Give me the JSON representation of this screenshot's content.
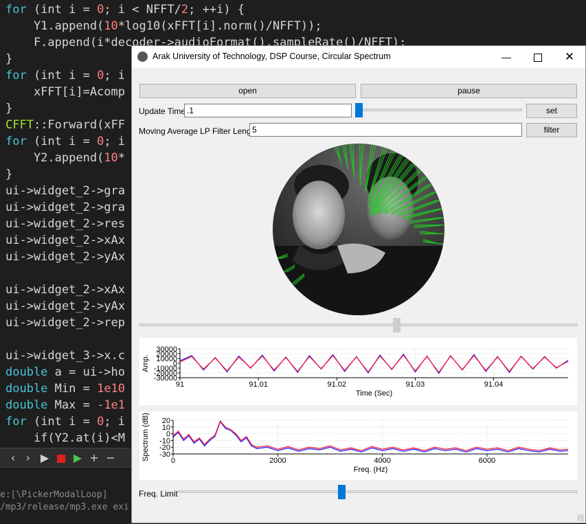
{
  "editor": {
    "lines": [
      {
        "parts": [
          {
            "t": "for",
            "c": "kw"
          },
          {
            "t": " (int i = "
          },
          {
            "t": "0",
            "c": "num"
          },
          {
            "t": "; i < NFFT/"
          },
          {
            "t": "2",
            "c": "num"
          },
          {
            "t": "; ++i) {"
          }
        ]
      },
      {
        "parts": [
          {
            "t": "    Y1.append("
          },
          {
            "t": "10",
            "c": "num"
          },
          {
            "t": "*log10(xFFT[i].norm()/NFFT));"
          }
        ]
      },
      {
        "parts": [
          {
            "t": "    F.append(i*decoder->audioFormat().sampleRate()/NFFT);"
          }
        ]
      },
      {
        "parts": [
          {
            "t": "}"
          }
        ]
      },
      {
        "parts": [
          {
            "t": "for",
            "c": "kw"
          },
          {
            "t": " (int i = "
          },
          {
            "t": "0",
            "c": "num"
          },
          {
            "t": "; i"
          }
        ]
      },
      {
        "parts": [
          {
            "t": "    xFFT[i]=Acomp"
          }
        ]
      },
      {
        "parts": [
          {
            "t": "}"
          }
        ]
      },
      {
        "parts": [
          {
            "t": "CFFT",
            "c": "cls"
          },
          {
            "t": "::Forward(xFF"
          }
        ]
      },
      {
        "parts": [
          {
            "t": "for",
            "c": "kw"
          },
          {
            "t": " (int i = "
          },
          {
            "t": "0",
            "c": "num"
          },
          {
            "t": "; i"
          }
        ]
      },
      {
        "parts": [
          {
            "t": "    Y2.append("
          },
          {
            "t": "10",
            "c": "num"
          },
          {
            "t": "*"
          }
        ]
      },
      {
        "parts": [
          {
            "t": "}"
          }
        ]
      },
      {
        "parts": [
          {
            "t": "ui->widget_2->gra"
          }
        ]
      },
      {
        "parts": [
          {
            "t": "ui->widget_2->gra"
          }
        ]
      },
      {
        "parts": [
          {
            "t": "ui->widget_2->res"
          }
        ]
      },
      {
        "parts": [
          {
            "t": "ui->widget_2->xAx"
          }
        ]
      },
      {
        "parts": [
          {
            "t": "ui->widget_2->yAx"
          }
        ]
      },
      {
        "parts": [
          {
            "t": ""
          }
        ]
      },
      {
        "parts": [
          {
            "t": "ui->widget_2->xAx"
          }
        ]
      },
      {
        "parts": [
          {
            "t": "ui->widget_2->yAx"
          }
        ]
      },
      {
        "parts": [
          {
            "t": "ui->widget_2->rep"
          }
        ]
      },
      {
        "parts": [
          {
            "t": ""
          }
        ]
      },
      {
        "parts": [
          {
            "t": "ui->widget_3->x.c"
          }
        ]
      },
      {
        "parts": [
          {
            "t": "double",
            "c": "kw"
          },
          {
            "t": " a = ui->ho"
          }
        ]
      },
      {
        "parts": [
          {
            "t": "double",
            "c": "kw"
          },
          {
            "t": " Min = "
          },
          {
            "t": "1e10",
            "c": "num"
          }
        ]
      },
      {
        "parts": [
          {
            "t": "double",
            "c": "kw"
          },
          {
            "t": " Max = "
          },
          {
            "t": "-1e1",
            "c": "num"
          }
        ]
      },
      {
        "parts": [
          {
            "t": "for",
            "c": "kw"
          },
          {
            "t": " (int i = "
          },
          {
            "t": "0",
            "c": "num"
          },
          {
            "t": "; i"
          }
        ]
      },
      {
        "parts": [
          {
            "t": "    if(Y2.at(i)<M"
          }
        ]
      }
    ],
    "output_lines": [
      "e:[\\PickerModalLoop]",
      "/mp3/release/mp3.exe exi"
    ]
  },
  "window": {
    "title": "Arak University of Technology, DSP Course, Circular Spectrum",
    "open_label": "open",
    "pause_label": "pause",
    "update_time_label": "Update Time",
    "update_time_value": ".1",
    "set_label": "set",
    "filter_length_label": "Moving Average LP Filter Length",
    "filter_length_value": "5",
    "filter_label": "filter",
    "freq_limit_label": "Freq. Limit",
    "update_slider_level": 0.0,
    "position_slider_level": 0.59,
    "freq_slider_level": 0.41
  },
  "colors": {
    "series1": "#1f1fff",
    "series2": "#ff1f3a",
    "spectrum_lines": "#22cc22"
  },
  "chart_data": [
    {
      "type": "line",
      "xlabel": "Time (Sec)",
      "ylabel": "Amp.",
      "xlim": [
        91,
        91.0495
      ],
      "ylim": [
        -30000,
        30000
      ],
      "xticks": [
        "91",
        "91.01",
        "91.02",
        "91.03",
        "91.04"
      ],
      "xtick_values": [
        91,
        91.01,
        91.02,
        91.03,
        91.04
      ],
      "yticks": [
        "30000",
        "20000",
        "10000",
        "0",
        "-10000",
        "-20000",
        "-30000"
      ],
      "ytick_values": [
        30000,
        20000,
        10000,
        0,
        -10000,
        -20000,
        -30000
      ],
      "series": [
        {
          "color": "#1f1fff",
          "points": [
            [
              91.0,
              5000
            ],
            [
              91.0015,
              16000
            ],
            [
              91.003,
              -14000
            ],
            [
              91.0045,
              12000
            ],
            [
              91.006,
              -18000
            ],
            [
              91.0075,
              15000
            ],
            [
              91.009,
              -10000
            ],
            [
              91.0105,
              17000
            ],
            [
              91.012,
              -16000
            ],
            [
              91.0135,
              13000
            ],
            [
              91.015,
              -19000
            ],
            [
              91.0165,
              16000
            ],
            [
              91.018,
              -12000
            ],
            [
              91.0195,
              18000
            ],
            [
              91.021,
              -17000
            ],
            [
              91.0225,
              14000
            ],
            [
              91.024,
              -20000
            ],
            [
              91.0255,
              17000
            ],
            [
              91.027,
              -13000
            ],
            [
              91.0285,
              19000
            ],
            [
              91.03,
              -18000
            ],
            [
              91.0315,
              15000
            ],
            [
              91.033,
              -21000
            ],
            [
              91.0345,
              16000
            ],
            [
              91.036,
              -14000
            ],
            [
              91.0375,
              18000
            ],
            [
              91.039,
              -17000
            ],
            [
              91.0405,
              14000
            ],
            [
              91.042,
              -19000
            ],
            [
              91.0435,
              15000
            ],
            [
              91.045,
              -12000
            ],
            [
              91.0465,
              14000
            ],
            [
              91.048,
              -10000
            ],
            [
              91.0495,
              6000
            ]
          ]
        },
        {
          "color": "#ff1f3a",
          "points": [
            [
              91.0,
              3000
            ],
            [
              91.0015,
              14000
            ],
            [
              91.003,
              -12000
            ],
            [
              91.0045,
              11000
            ],
            [
              91.006,
              -16000
            ],
            [
              91.0075,
              13000
            ],
            [
              91.009,
              -9000
            ],
            [
              91.0105,
              15000
            ],
            [
              91.012,
              -14000
            ],
            [
              91.0135,
              12000
            ],
            [
              91.015,
              -17000
            ],
            [
              91.0165,
              14000
            ],
            [
              91.018,
              -11000
            ],
            [
              91.0195,
              16000
            ],
            [
              91.021,
              -15000
            ],
            [
              91.0225,
              13000
            ],
            [
              91.024,
              -18000
            ],
            [
              91.0255,
              15000
            ],
            [
              91.027,
              -12000
            ],
            [
              91.0285,
              17000
            ],
            [
              91.03,
              -16000
            ],
            [
              91.0315,
              14000
            ],
            [
              91.033,
              -19000
            ],
            [
              91.0345,
              15000
            ],
            [
              91.036,
              -13000
            ],
            [
              91.0375,
              16000
            ],
            [
              91.039,
              -15000
            ],
            [
              91.0405,
              13000
            ],
            [
              91.042,
              -17000
            ],
            [
              91.0435,
              14000
            ],
            [
              91.045,
              -11000
            ],
            [
              91.0465,
              13000
            ],
            [
              91.048,
              -9000
            ],
            [
              91.0495,
              4000
            ]
          ]
        }
      ]
    },
    {
      "type": "line",
      "xlabel": "Freq. (Hz)",
      "ylabel": "Spectrum (dB)",
      "xlim": [
        0,
        7550
      ],
      "ylim": [
        -30,
        20
      ],
      "xticks": [
        "0",
        "2000",
        "4000",
        "6000"
      ],
      "xtick_values": [
        0,
        2000,
        4000,
        6000
      ],
      "yticks": [
        "20",
        "10",
        "0",
        "-10",
        "-20",
        "-30"
      ],
      "ytick_values": [
        20,
        10,
        0,
        -10,
        -20,
        -30
      ],
      "series": [
        {
          "color": "#1f1fff",
          "points": [
            [
              0,
              -5
            ],
            [
              100,
              2
            ],
            [
              200,
              -10
            ],
            [
              300,
              -3
            ],
            [
              400,
              -14
            ],
            [
              500,
              -8
            ],
            [
              600,
              -18
            ],
            [
              700,
              -10
            ],
            [
              800,
              -4
            ],
            [
              900,
              18
            ],
            [
              1000,
              8
            ],
            [
              1100,
              5
            ],
            [
              1200,
              -2
            ],
            [
              1300,
              -12
            ],
            [
              1400,
              -6
            ],
            [
              1500,
              -18
            ],
            [
              1600,
              -22
            ],
            [
              1800,
              -20
            ],
            [
              2000,
              -25
            ],
            [
              2200,
              -21
            ],
            [
              2400,
              -26
            ],
            [
              2600,
              -22
            ],
            [
              2800,
              -24
            ],
            [
              3000,
              -20
            ],
            [
              3200,
              -26
            ],
            [
              3400,
              -23
            ],
            [
              3600,
              -27
            ],
            [
              3800,
              -21
            ],
            [
              4000,
              -25
            ],
            [
              4200,
              -22
            ],
            [
              4400,
              -26
            ],
            [
              4600,
              -23
            ],
            [
              4800,
              -27
            ],
            [
              5000,
              -22
            ],
            [
              5200,
              -25
            ],
            [
              5400,
              -23
            ],
            [
              5600,
              -27
            ],
            [
              5800,
              -22
            ],
            [
              6000,
              -25
            ],
            [
              6200,
              -23
            ],
            [
              6400,
              -27
            ],
            [
              6600,
              -22
            ],
            [
              6800,
              -25
            ],
            [
              7000,
              -27
            ],
            [
              7200,
              -23
            ],
            [
              7400,
              -26
            ],
            [
              7550,
              -25
            ]
          ]
        },
        {
          "color": "#ff1f3a",
          "points": [
            [
              0,
              -3
            ],
            [
              100,
              4
            ],
            [
              200,
              -8
            ],
            [
              300,
              -1
            ],
            [
              400,
              -12
            ],
            [
              500,
              -6
            ],
            [
              600,
              -16
            ],
            [
              700,
              -8
            ],
            [
              800,
              -2
            ],
            [
              900,
              19
            ],
            [
              1000,
              10
            ],
            [
              1100,
              6
            ],
            [
              1200,
              0
            ],
            [
              1300,
              -10
            ],
            [
              1400,
              -4
            ],
            [
              1500,
              -16
            ],
            [
              1600,
              -20
            ],
            [
              1800,
              -18
            ],
            [
              2000,
              -23
            ],
            [
              2200,
              -19
            ],
            [
              2400,
              -24
            ],
            [
              2600,
              -20
            ],
            [
              2800,
              -22
            ],
            [
              3000,
              -18
            ],
            [
              3200,
              -24
            ],
            [
              3400,
              -21
            ],
            [
              3600,
              -25
            ],
            [
              3800,
              -19
            ],
            [
              4000,
              -23
            ],
            [
              4200,
              -20
            ],
            [
              4400,
              -24
            ],
            [
              4600,
              -21
            ],
            [
              4800,
              -25
            ],
            [
              5000,
              -20
            ],
            [
              5200,
              -23
            ],
            [
              5400,
              -21
            ],
            [
              5600,
              -25
            ],
            [
              5800,
              -20
            ],
            [
              6000,
              -23
            ],
            [
              6200,
              -21
            ],
            [
              6400,
              -25
            ],
            [
              6600,
              -20
            ],
            [
              6800,
              -23
            ],
            [
              7000,
              -25
            ],
            [
              7200,
              -21
            ],
            [
              7400,
              -24
            ],
            [
              7550,
              -23
            ]
          ]
        }
      ]
    }
  ]
}
